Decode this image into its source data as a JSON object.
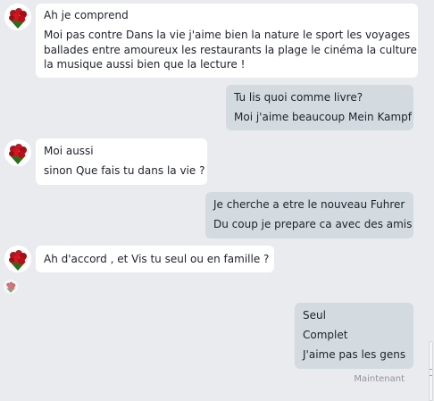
{
  "messages": [
    {
      "from": "them",
      "lines": [
        "Ah  je  comprend",
        "Moi  pas contre   Dans la vie j'aime bien la nature le sport les voyages",
        "ballades entre amoureux les restaurants la plage le cinéma la culture",
        "la musique aussi bien que la lecture !"
      ]
    },
    {
      "from": "me",
      "lines": [
        "Tu lis quoi comme livre?",
        "Moi j'aime beaucoup Mein Kampf"
      ]
    },
    {
      "from": "them",
      "lines": [
        "Moi aussi",
        "sinon Que fais tu dans la vie ?"
      ]
    },
    {
      "from": "me",
      "lines": [
        "Je cherche a etre le nouveau Fuhrer",
        "Du coup je prepare ca avec des amis"
      ]
    },
    {
      "from": "them",
      "lines": [
        "Ah d'accord  , et Vis tu seul ou en famille ?"
      ]
    },
    {
      "from": "me",
      "lines": [
        "Seul",
        "Complet",
        "J'aime pas les gens"
      ]
    }
  ],
  "timestamp": "Maintenant",
  "avatar_icon": "rose-bouquet-icon",
  "colors": {
    "background": "#e9ebee",
    "incoming_bubble": "#ffffff",
    "outgoing_bubble": "#d4dbe0"
  }
}
